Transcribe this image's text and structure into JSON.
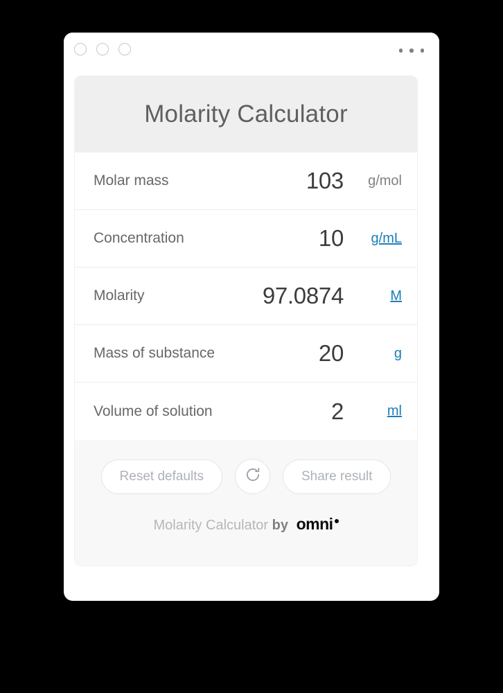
{
  "window": {
    "traffic_lights": [
      "circle-1",
      "circle-2",
      "circle-3"
    ],
    "menu_icon": "kebab-menu-icon"
  },
  "calculator": {
    "title": "Molarity Calculator",
    "rows": [
      {
        "label": "Molar mass",
        "value": "103",
        "unit": "g/mol",
        "unit_style": "plain"
      },
      {
        "label": "Concentration",
        "value": "10",
        "unit": "g/mL",
        "unit_style": "link"
      },
      {
        "label": "Molarity",
        "value": "97.0874",
        "unit": "M",
        "unit_style": "link"
      },
      {
        "label": "Mass of substance",
        "value": "20",
        "unit": "g",
        "unit_style": "nolink"
      },
      {
        "label": "Volume of solution",
        "value": "2",
        "unit": "ml",
        "unit_style": "link"
      }
    ]
  },
  "footer": {
    "reset_label": "Reset defaults",
    "refresh_icon": "refresh-icon",
    "share_label": "Share result",
    "brand_name": "Molarity Calculator",
    "brand_by": "by",
    "brand_omni": "omni"
  },
  "colors": {
    "accent_link": "#1a7db8",
    "header_bg": "#efefef",
    "footer_bg": "#f8f8f8",
    "page_bg": "#000000",
    "value_text": "#3c3c3c",
    "label_text": "#676767"
  }
}
